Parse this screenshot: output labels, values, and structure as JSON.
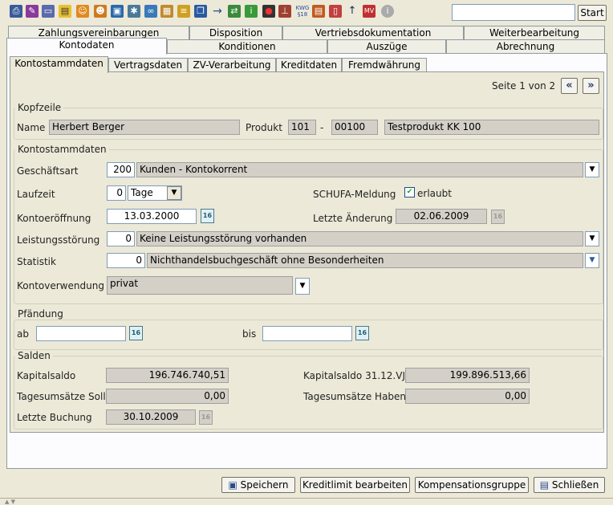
{
  "toolbar": {
    "search_value": "",
    "start_label": "Start",
    "icons": [
      "printer-icon",
      "edit-icon",
      "card-icon",
      "note-icon",
      "person-add-icon",
      "person-edit-icon",
      "window-icon",
      "share-icon",
      "link-icon",
      "calendar-icon",
      "coins-icon",
      "copy-icon",
      "arrow-icon",
      "transfer-icon",
      "info-icon",
      "traffic-light-icon",
      "stamp-icon",
      "law-icon",
      "report-icon",
      "document-icon",
      "arrow-up-icon",
      "alert-icon",
      "help-icon"
    ],
    "law_label": "KWG §18",
    "mv_label": "MV"
  },
  "tabs_row1": [
    "Zahlungsvereinbarungen",
    "Disposition",
    "Vertriebsdokumentation",
    "Weiterbearbeitung"
  ],
  "tabs_row2": [
    "Kontodaten",
    "Konditionen",
    "Auszüge",
    "Abrechnung"
  ],
  "subtabs": [
    "Kontostammdaten",
    "Vertragsdaten",
    "ZV-Verarbeitung",
    "Kreditdaten",
    "Fremdwährung"
  ],
  "pager": {
    "text": "Seite 1 von 2",
    "prev": "«",
    "next": "»"
  },
  "kopfzeile": {
    "legend": "Kopfzeile",
    "name_label": "Name",
    "name_value": "Herbert Berger",
    "produkt_label": "Produkt",
    "produkt_code1": "101",
    "dash": "-",
    "produkt_code2": "00100",
    "produkt_name": "Testprodukt KK 100"
  },
  "stammdaten": {
    "legend": "Kontostammdaten",
    "geschaeftsart_label": "Geschäftsart",
    "geschaeftsart_code": "200",
    "geschaeftsart_text": "Kunden - Kontokorrent",
    "laufzeit_label": "Laufzeit",
    "laufzeit_value": "0",
    "laufzeit_unit": "Tage",
    "schufa_label": "SCHUFA-Meldung",
    "schufa_checkbox": "✔",
    "schufa_value": "erlaubt",
    "eroeffnung_label": "Kontoeröffnung",
    "eroeffnung_value": "13.03.2000",
    "aenderung_label": "Letzte Änderung",
    "aenderung_value": "02.06.2009",
    "leistung_label": "Leistungsstörung",
    "leistung_code": "0",
    "leistung_text": "Keine Leistungsstörung vorhanden",
    "statistik_label": "Statistik",
    "statistik_code": "0",
    "statistik_text": "Nichthandelsbuchgeschäft ohne Besonderheiten",
    "verwendung_label": "Kontoverwendung",
    "verwendung_value": "privat"
  },
  "pfaendung": {
    "legend": "Pfändung",
    "ab_label": "ab",
    "ab_value": "",
    "bis_label": "bis",
    "bis_value": ""
  },
  "salden": {
    "legend": "Salden",
    "kapitalsaldo_label": "Kapitalsaldo",
    "kapitalsaldo_value": "196.746.740,51",
    "kapitalsaldo_vj_label": "Kapitalsaldo 31.12.VJ",
    "kapitalsaldo_vj_value": "199.896.513,66",
    "soll_label": "Tagesumsätze Soll",
    "soll_value": "0,00",
    "haben_label": "Tagesumsätze Haben",
    "haben_value": "0,00",
    "buchung_label": "Letzte Buchung",
    "buchung_value": "30.10.2009"
  },
  "calendar_glyph": "16",
  "dropdown_glyph": "▼",
  "footer": {
    "save_label": "Speichern",
    "kreditlimit_label": "Kreditlimit bearbeiten",
    "kompensation_label": "Kompensationsgruppe",
    "close_label": "Schließen"
  }
}
